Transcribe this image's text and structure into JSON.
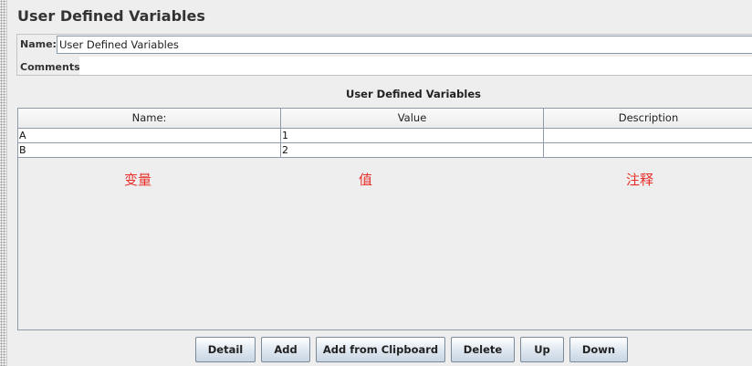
{
  "panel": {
    "title": "User Defined Variables"
  },
  "form": {
    "name_label": "Name:",
    "name_value": "User Defined Variables",
    "comments_label": "Comments:",
    "comments_value": ""
  },
  "table": {
    "title": "User Defined Variables",
    "columns": [
      "Name:",
      "Value",
      "Description"
    ],
    "rows": [
      {
        "name": "A",
        "value": "1",
        "description": ""
      },
      {
        "name": "B",
        "value": "2",
        "description": ""
      }
    ]
  },
  "annotations": {
    "name": "变量",
    "value": "值",
    "description": "注释",
    "color": "#e8302a"
  },
  "buttons": {
    "detail": "Detail",
    "add": "Add",
    "add_from_clipboard": "Add from Clipboard",
    "delete": "Delete",
    "up": "Up",
    "down": "Down"
  }
}
